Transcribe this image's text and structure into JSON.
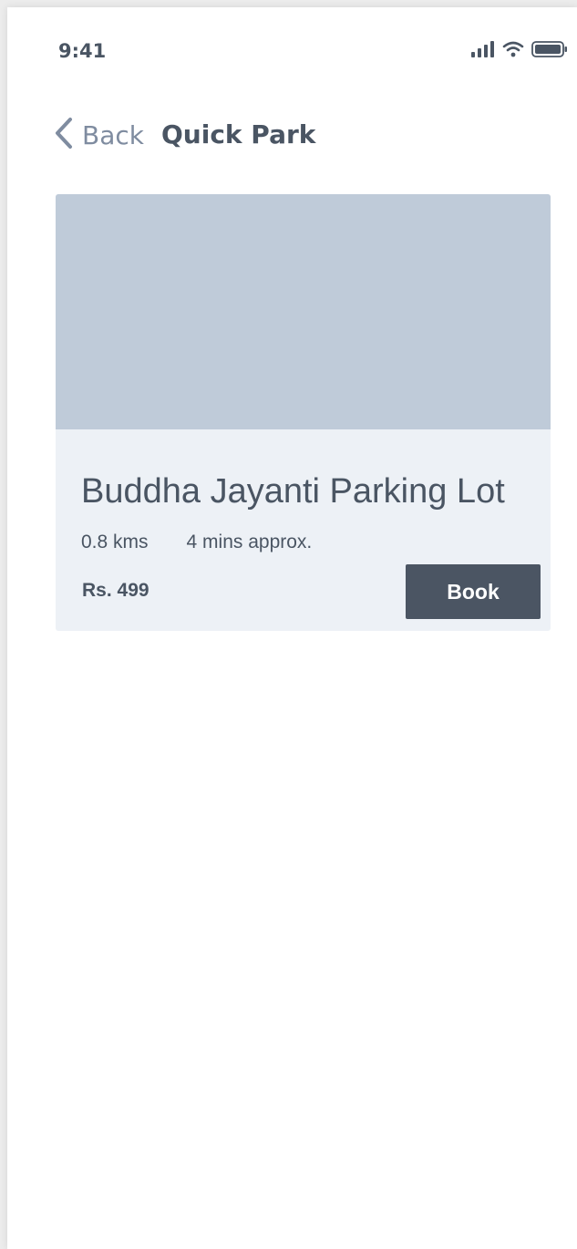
{
  "status_bar": {
    "time": "9:41",
    "icons": [
      "signal-icon",
      "wifi-icon",
      "battery-icon"
    ]
  },
  "nav": {
    "back_label": "Back",
    "back_icon": "chevron-left-icon",
    "title": "Quick Park"
  },
  "card": {
    "title": "Buddha Jayanti Parking Lot",
    "distance": "0.8 kms",
    "duration": "4 mins approx.",
    "price": "Rs. 499",
    "book_label": "Book"
  },
  "colors": {
    "text": "#4a5563",
    "muted": "#7f8ca0",
    "card_bg": "#edf1f6",
    "image_placeholder": "#bfcbd9",
    "button_bg": "#4b5563"
  }
}
